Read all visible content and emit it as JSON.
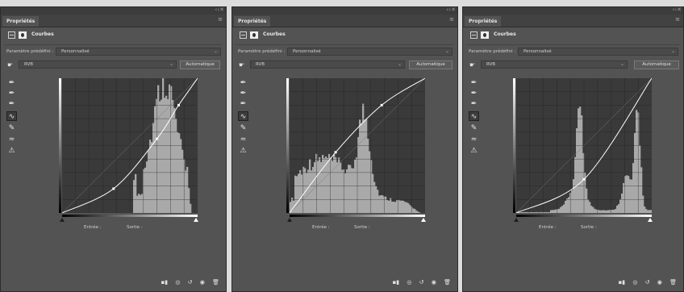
{
  "panels": [
    {
      "tab": "Propriétés",
      "header_title": "Courbes",
      "preset_label": "Paramètre prédéfini :",
      "preset_value": "Personnalisé",
      "channel": "RVB",
      "auto_label": "Automatique",
      "input_label": "Entrée :",
      "output_label": "Sortie :",
      "histogram_shape": "right",
      "curve_points": [
        [
          0,
          0
        ],
        [
          0.38,
          0.18
        ],
        [
          0.7,
          0.55
        ],
        [
          0.86,
          0.8
        ],
        [
          1,
          1
        ]
      ]
    },
    {
      "tab": "Propriétés",
      "header_title": "Courbes",
      "preset_label": "Paramètre prédéfini :",
      "preset_value": "Personnalisé",
      "channel": "RVB",
      "auto_label": "Automatique",
      "input_label": "Entrée :",
      "output_label": "Sortie :",
      "histogram_shape": "spread",
      "curve_points": [
        [
          0,
          0
        ],
        [
          0.34,
          0.45
        ],
        [
          0.68,
          0.8
        ],
        [
          1,
          1
        ]
      ]
    },
    {
      "tab": "Propriétés",
      "header_title": "Courbes",
      "preset_label": "Paramètre prédéfini :",
      "preset_value": "Personnalisé",
      "channel": "RVB",
      "auto_label": "Automatique",
      "input_label": "Entrée :",
      "output_label": "Sortie :",
      "histogram_shape": "bimodal",
      "curve_points": [
        [
          0,
          0
        ],
        [
          0.5,
          0.25
        ],
        [
          1,
          1
        ]
      ]
    }
  ],
  "icons": {
    "window_collapse": "double-chevron-icon",
    "window_close": "close-icon",
    "tab_menu": "menu-icon",
    "hand": "hand-tool-icon",
    "tools": [
      "eyedropper-black-icon",
      "eyedropper-gray-icon",
      "eyedropper-white-icon",
      "curve-edit-icon",
      "pencil-icon",
      "smooth-icon",
      "warning-icon"
    ],
    "bottom": [
      "clip-icon",
      "visibility-previous-icon",
      "reset-icon",
      "eye-icon",
      "trash-icon"
    ]
  },
  "colors": {
    "panel_bg": "#535353",
    "graph_bg": "#3a3a3a",
    "histogram": "#a9a9a9",
    "curve": "#ffffff"
  }
}
